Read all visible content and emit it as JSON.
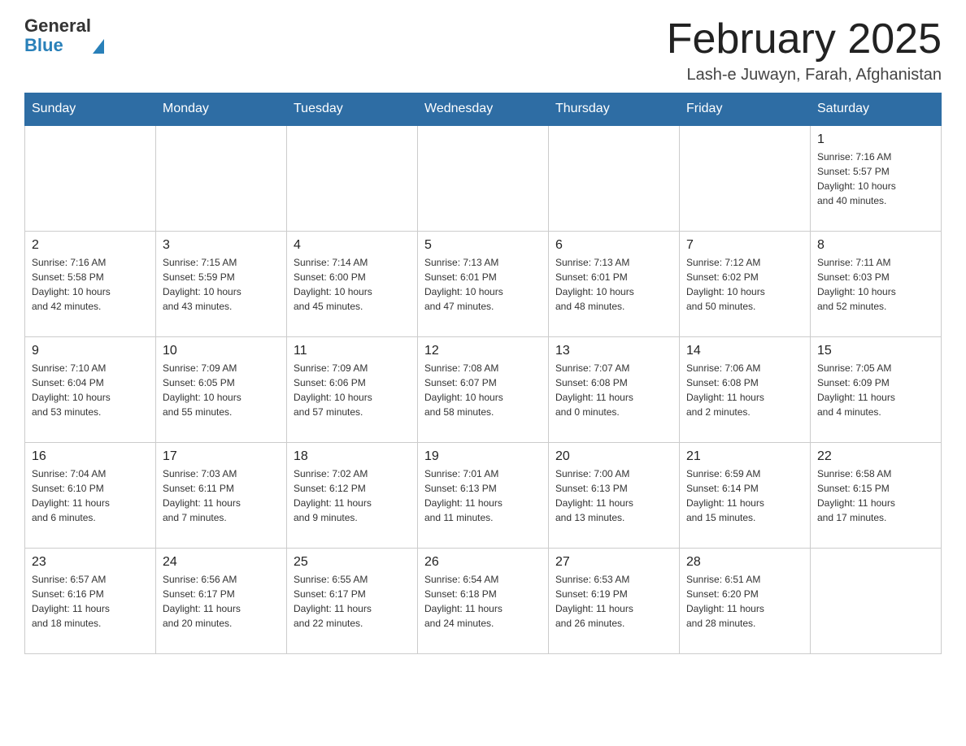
{
  "logo": {
    "general": "General",
    "blue": "Blue"
  },
  "title": "February 2025",
  "subtitle": "Lash-e Juwayn, Farah, Afghanistan",
  "days_of_week": [
    "Sunday",
    "Monday",
    "Tuesday",
    "Wednesday",
    "Thursday",
    "Friday",
    "Saturday"
  ],
  "weeks": [
    [
      {
        "day": "",
        "info": ""
      },
      {
        "day": "",
        "info": ""
      },
      {
        "day": "",
        "info": ""
      },
      {
        "day": "",
        "info": ""
      },
      {
        "day": "",
        "info": ""
      },
      {
        "day": "",
        "info": ""
      },
      {
        "day": "1",
        "info": "Sunrise: 7:16 AM\nSunset: 5:57 PM\nDaylight: 10 hours\nand 40 minutes."
      }
    ],
    [
      {
        "day": "2",
        "info": "Sunrise: 7:16 AM\nSunset: 5:58 PM\nDaylight: 10 hours\nand 42 minutes."
      },
      {
        "day": "3",
        "info": "Sunrise: 7:15 AM\nSunset: 5:59 PM\nDaylight: 10 hours\nand 43 minutes."
      },
      {
        "day": "4",
        "info": "Sunrise: 7:14 AM\nSunset: 6:00 PM\nDaylight: 10 hours\nand 45 minutes."
      },
      {
        "day": "5",
        "info": "Sunrise: 7:13 AM\nSunset: 6:01 PM\nDaylight: 10 hours\nand 47 minutes."
      },
      {
        "day": "6",
        "info": "Sunrise: 7:13 AM\nSunset: 6:01 PM\nDaylight: 10 hours\nand 48 minutes."
      },
      {
        "day": "7",
        "info": "Sunrise: 7:12 AM\nSunset: 6:02 PM\nDaylight: 10 hours\nand 50 minutes."
      },
      {
        "day": "8",
        "info": "Sunrise: 7:11 AM\nSunset: 6:03 PM\nDaylight: 10 hours\nand 52 minutes."
      }
    ],
    [
      {
        "day": "9",
        "info": "Sunrise: 7:10 AM\nSunset: 6:04 PM\nDaylight: 10 hours\nand 53 minutes."
      },
      {
        "day": "10",
        "info": "Sunrise: 7:09 AM\nSunset: 6:05 PM\nDaylight: 10 hours\nand 55 minutes."
      },
      {
        "day": "11",
        "info": "Sunrise: 7:09 AM\nSunset: 6:06 PM\nDaylight: 10 hours\nand 57 minutes."
      },
      {
        "day": "12",
        "info": "Sunrise: 7:08 AM\nSunset: 6:07 PM\nDaylight: 10 hours\nand 58 minutes."
      },
      {
        "day": "13",
        "info": "Sunrise: 7:07 AM\nSunset: 6:08 PM\nDaylight: 11 hours\nand 0 minutes."
      },
      {
        "day": "14",
        "info": "Sunrise: 7:06 AM\nSunset: 6:08 PM\nDaylight: 11 hours\nand 2 minutes."
      },
      {
        "day": "15",
        "info": "Sunrise: 7:05 AM\nSunset: 6:09 PM\nDaylight: 11 hours\nand 4 minutes."
      }
    ],
    [
      {
        "day": "16",
        "info": "Sunrise: 7:04 AM\nSunset: 6:10 PM\nDaylight: 11 hours\nand 6 minutes."
      },
      {
        "day": "17",
        "info": "Sunrise: 7:03 AM\nSunset: 6:11 PM\nDaylight: 11 hours\nand 7 minutes."
      },
      {
        "day": "18",
        "info": "Sunrise: 7:02 AM\nSunset: 6:12 PM\nDaylight: 11 hours\nand 9 minutes."
      },
      {
        "day": "19",
        "info": "Sunrise: 7:01 AM\nSunset: 6:13 PM\nDaylight: 11 hours\nand 11 minutes."
      },
      {
        "day": "20",
        "info": "Sunrise: 7:00 AM\nSunset: 6:13 PM\nDaylight: 11 hours\nand 13 minutes."
      },
      {
        "day": "21",
        "info": "Sunrise: 6:59 AM\nSunset: 6:14 PM\nDaylight: 11 hours\nand 15 minutes."
      },
      {
        "day": "22",
        "info": "Sunrise: 6:58 AM\nSunset: 6:15 PM\nDaylight: 11 hours\nand 17 minutes."
      }
    ],
    [
      {
        "day": "23",
        "info": "Sunrise: 6:57 AM\nSunset: 6:16 PM\nDaylight: 11 hours\nand 18 minutes."
      },
      {
        "day": "24",
        "info": "Sunrise: 6:56 AM\nSunset: 6:17 PM\nDaylight: 11 hours\nand 20 minutes."
      },
      {
        "day": "25",
        "info": "Sunrise: 6:55 AM\nSunset: 6:17 PM\nDaylight: 11 hours\nand 22 minutes."
      },
      {
        "day": "26",
        "info": "Sunrise: 6:54 AM\nSunset: 6:18 PM\nDaylight: 11 hours\nand 24 minutes."
      },
      {
        "day": "27",
        "info": "Sunrise: 6:53 AM\nSunset: 6:19 PM\nDaylight: 11 hours\nand 26 minutes."
      },
      {
        "day": "28",
        "info": "Sunrise: 6:51 AM\nSunset: 6:20 PM\nDaylight: 11 hours\nand 28 minutes."
      },
      {
        "day": "",
        "info": ""
      }
    ]
  ]
}
